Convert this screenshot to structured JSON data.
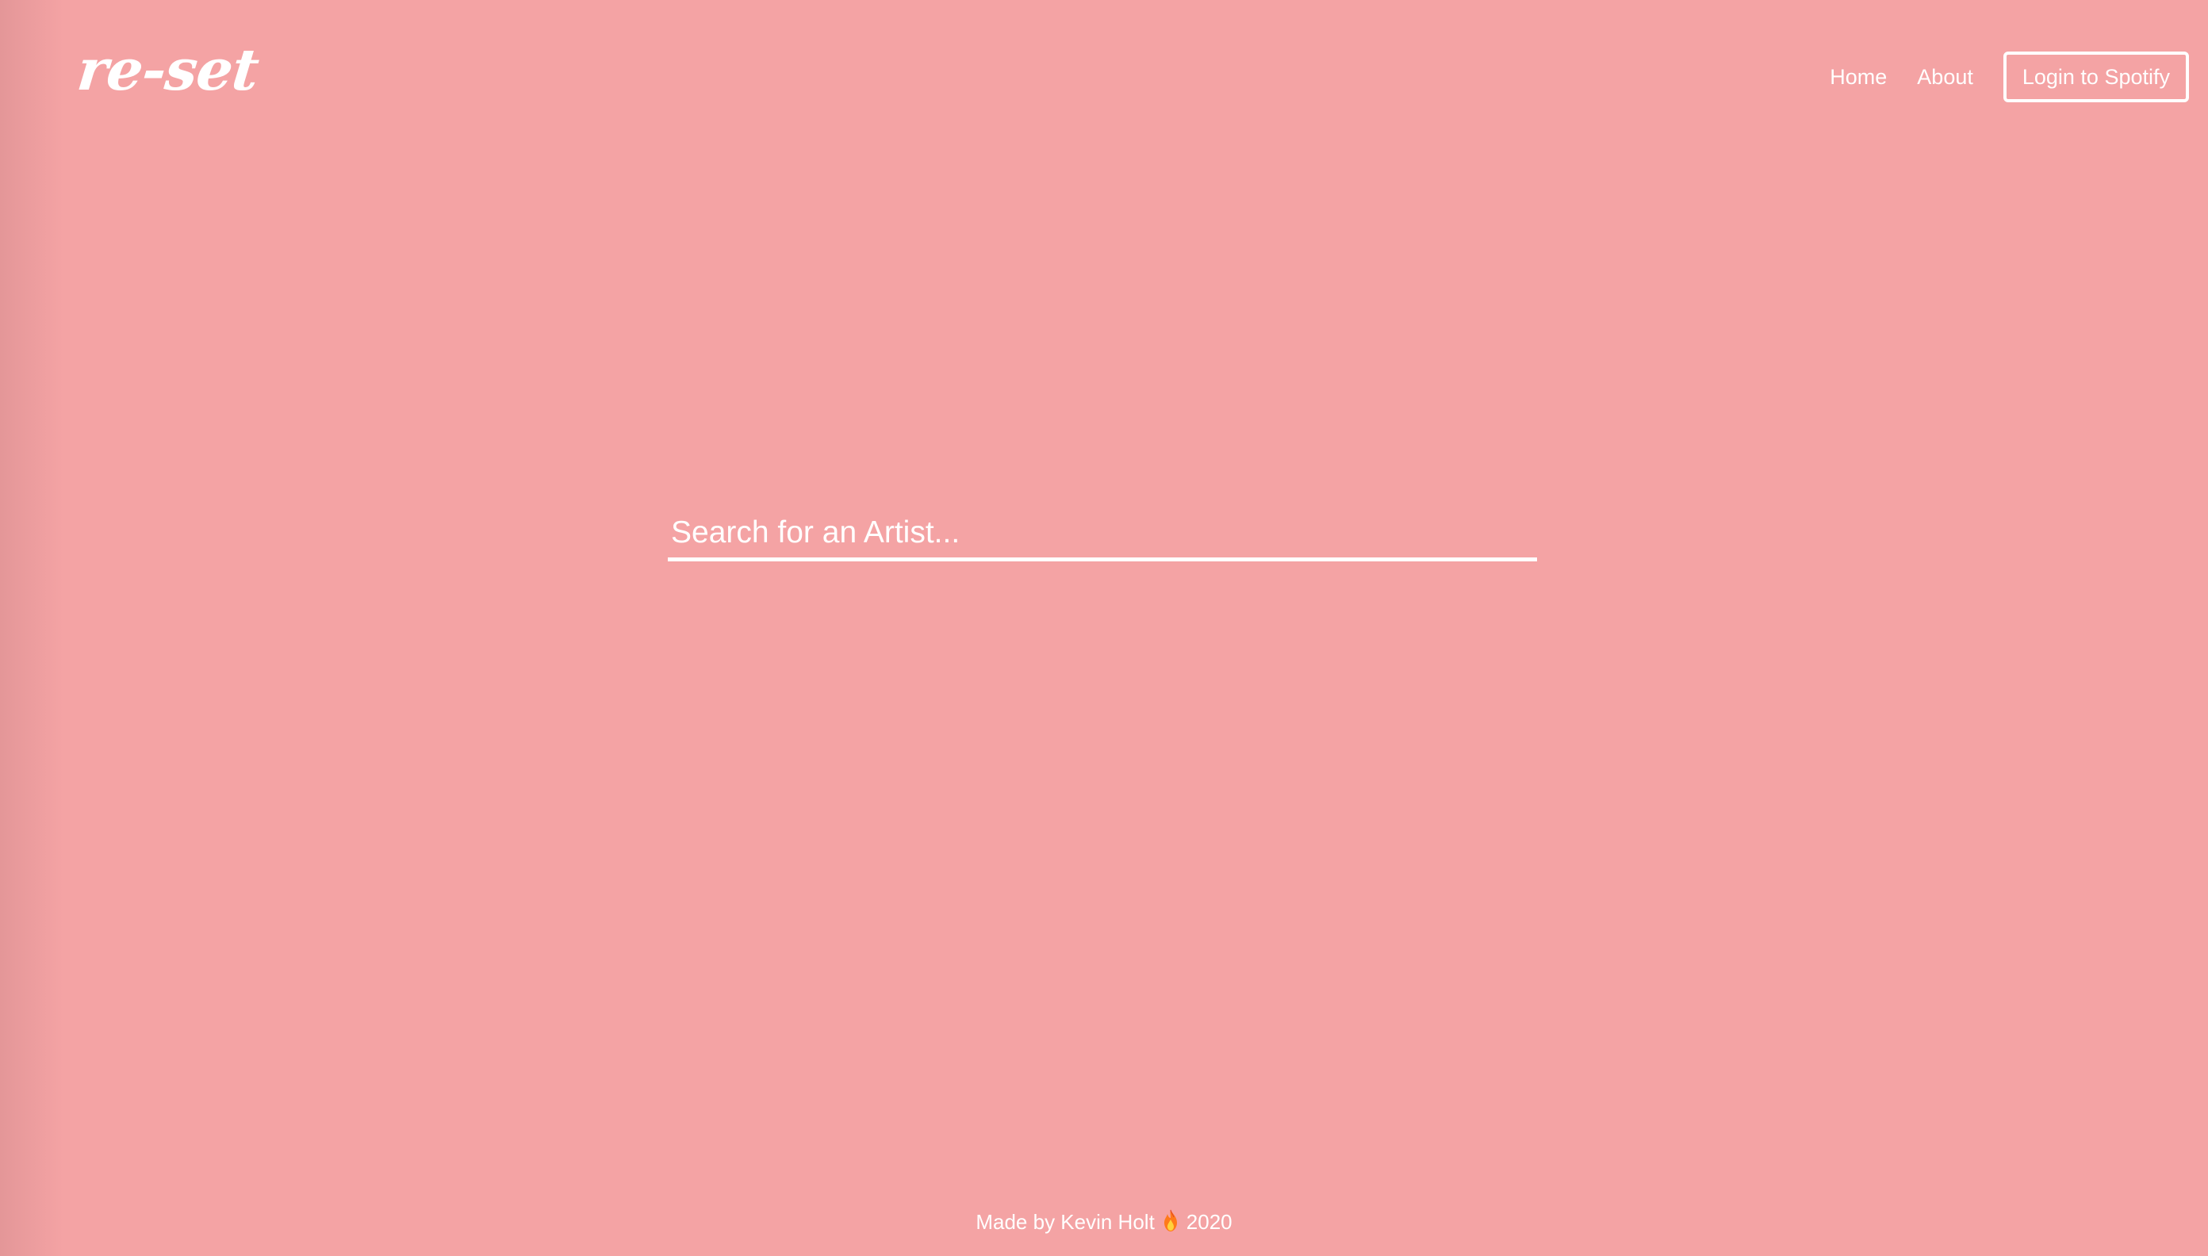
{
  "header": {
    "logo": "re-set",
    "nav": {
      "home_label": "Home",
      "about_label": "About",
      "login_label": "Login to Spotify"
    }
  },
  "search": {
    "placeholder": "Search for an Artist...",
    "value": ""
  },
  "footer": {
    "text_before": "Made by Kevin Holt",
    "icon": "fire-icon",
    "year": "2020"
  },
  "colors": {
    "background": "#f4a3a4",
    "foreground": "#ffffff"
  }
}
